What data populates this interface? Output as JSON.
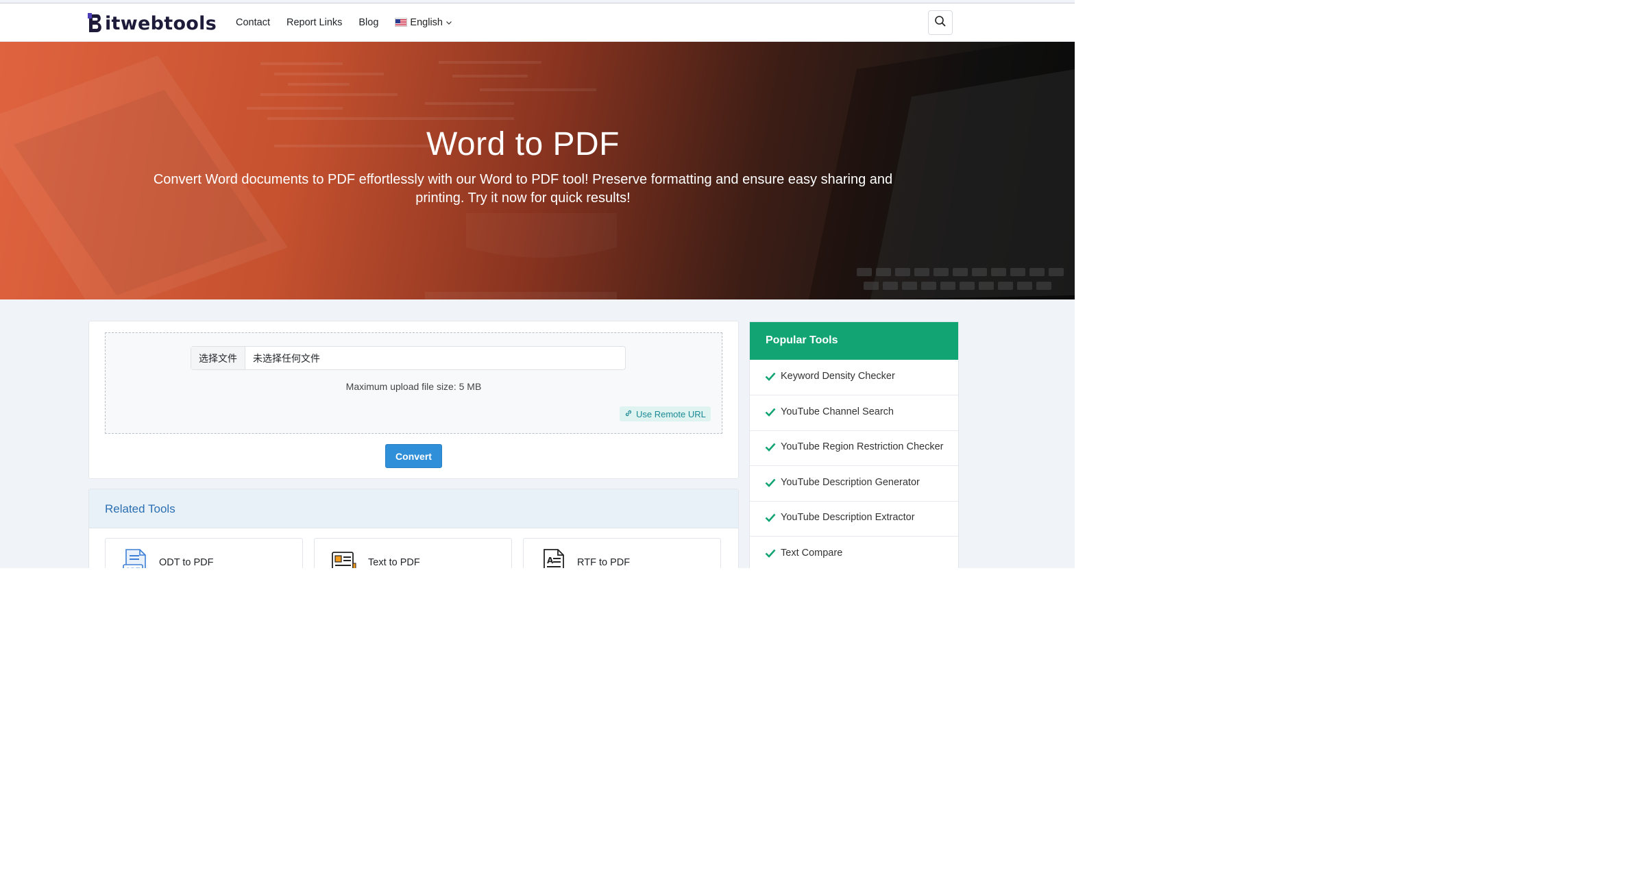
{
  "header": {
    "logo_text": "itwebtools",
    "nav": [
      "Contact",
      "Report Links",
      "Blog"
    ],
    "language": "English"
  },
  "hero": {
    "title": "Word to PDF",
    "subtitle": "Convert Word documents to PDF effortlessly with our Word to PDF tool! Preserve formatting and ensure easy sharing and printing. Try it now for quick results!"
  },
  "tool": {
    "choose_file": "选择文件",
    "no_file": "未选择任何文件",
    "max_size": "Maximum upload file size: 5 MB",
    "remote_url": "Use Remote URL",
    "convert": "Convert"
  },
  "related": {
    "title": "Related Tools",
    "items": [
      {
        "label": "ODT to PDF",
        "icon": "odt-file-icon"
      },
      {
        "label": "Text to PDF",
        "icon": "text-document-icon"
      },
      {
        "label": "RTF to PDF",
        "icon": "rtf-document-icon"
      }
    ]
  },
  "popular": {
    "title": "Popular Tools",
    "items": [
      "Keyword Density Checker",
      "YouTube Channel Search",
      "YouTube Region Restriction Checker",
      "YouTube Description Generator",
      "YouTube Description Extractor",
      "Text Compare"
    ]
  },
  "colors": {
    "accent_green": "#12a473",
    "convert_blue": "#2f8fd8",
    "hero_orange": "#e0633f"
  }
}
